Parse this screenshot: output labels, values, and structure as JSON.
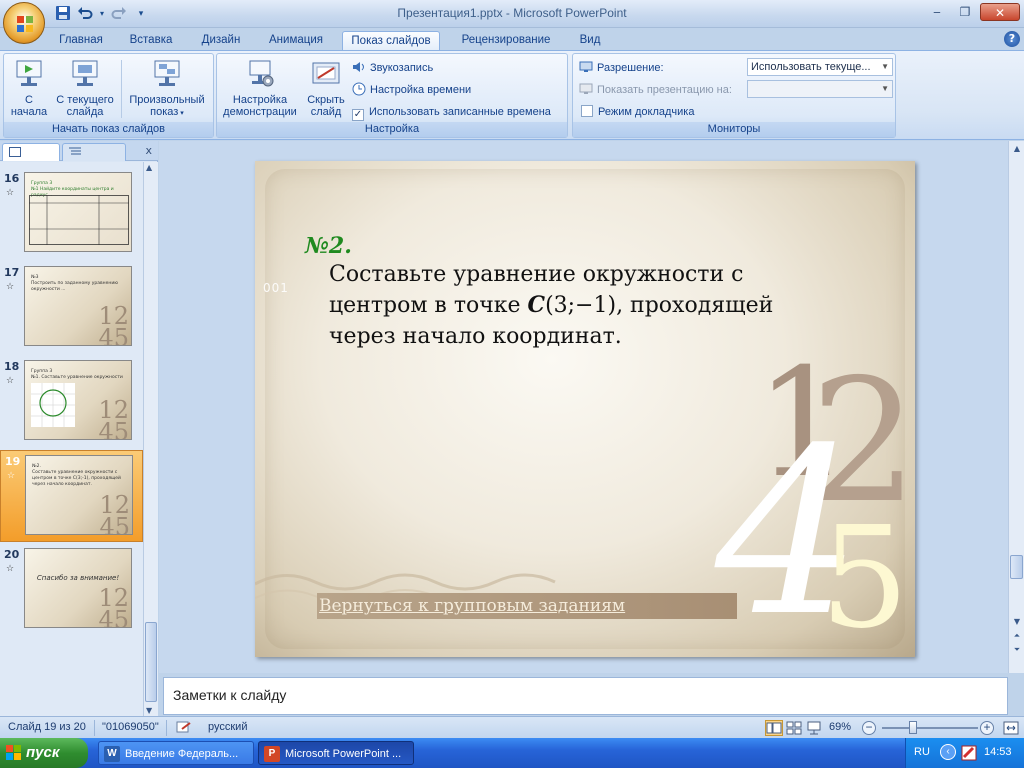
{
  "window": {
    "title": "Презентация1.pptx - Microsoft PowerPoint",
    "minimize": "‒",
    "maximize": "❐",
    "close": "✕"
  },
  "qat": {
    "save": "💾",
    "undo": "↶",
    "redo": "↷",
    "customize": "▾"
  },
  "tabs": [
    "Главная",
    "Вставка",
    "Дизайн",
    "Анимация",
    "Показ слайдов",
    "Рецензирование",
    "Вид"
  ],
  "active_tab": "Показ слайдов",
  "ribbon": {
    "group_start": {
      "label": "Начать показ слайдов",
      "from_start": "С\nначала",
      "from_current": "С текущего\nслайда",
      "custom": "Произвольный\nпоказ"
    },
    "group_setup": {
      "label": "Настройка",
      "setup_show": "Настройка\nдемонстрации",
      "hide_slide": "Скрыть\nслайд",
      "record_narration": "Звукозапись",
      "rehearse_timings": "Настройка времени",
      "use_timings": "Использовать записанные времена",
      "use_timings_checked": true
    },
    "group_monitors": {
      "label": "Мониторы",
      "resolution_label": "Разрешение:",
      "resolution_value": "Использовать текуще...",
      "show_on_label": "Показать презентацию на:",
      "show_on_value": "",
      "presenter_view": "Режим докладчика",
      "presenter_view_checked": false
    }
  },
  "thumbnails": [
    {
      "num": "16",
      "text": "Группа 3\n№1 Найдите координаты центра и радиус...",
      "deco": ""
    },
    {
      "num": "17",
      "text": "№3\nПостроить по заданному уравнению окружности ...",
      "deco": "12\n45"
    },
    {
      "num": "18",
      "text": "Группа 3\n№1. Составьте уравнение окружности ...",
      "deco": "12\n45"
    },
    {
      "num": "19",
      "text": "№2.\nСоставьте уравнение окружности с центром в точке C(3;-1), проходящей через начало координат.",
      "deco": "12\n45"
    },
    {
      "num": "20",
      "text": "Спасибо за внимание!",
      "deco": "12\n45"
    }
  ],
  "selected_thumbnail": "19",
  "slide": {
    "task_number": "№2.",
    "text_line1": "Составьте уравнение окружности с",
    "text_line2a": "центром в точке ",
    "text_point": "C",
    "text_line2b": "(3;−1), проходящей",
    "text_line3": "через начало координат.",
    "corner_code": "001",
    "deco_1": "1",
    "deco_2": "2",
    "deco_4": "4",
    "deco_5": "5",
    "back_link": "Вернуться к групповым заданиям"
  },
  "notes_placeholder": "Заметки к слайду",
  "status": {
    "slide_info": "Слайд 19 из 20",
    "theme": "\"01069050\"",
    "language": "русский",
    "zoom": "69%",
    "zoom_fraction": 0.69
  },
  "taskbar": {
    "start": "пуск",
    "tasks": [
      "Введение Федераль...",
      "Microsoft PowerPoint ..."
    ],
    "lang": "RU",
    "clock": "14:53"
  },
  "colors": {
    "task_number": "#1f8a1f",
    "thumb_selected": "#f39d2a",
    "taskbar": "#2764d8"
  }
}
